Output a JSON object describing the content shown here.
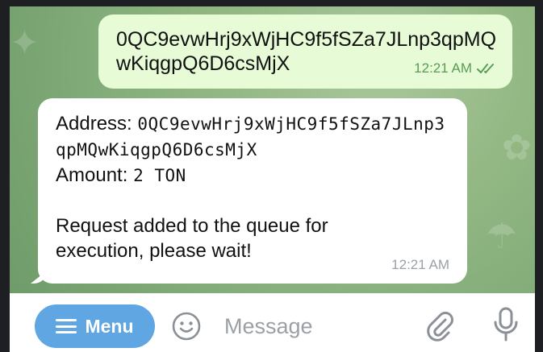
{
  "outgoing": {
    "text": "0QC9evwHrj9xWjHC9f5fSZa7JLnp3qpMQwKiqgpQ6D6csMjX",
    "time": "12:21 AM",
    "status_icon": "double-check-icon"
  },
  "incoming": {
    "address_label": "Address:",
    "address_value": "0QC9evwHrj9xWjHC9f5fSZa7JLnp3qpMQwKiqgpQ6D6csMjX",
    "amount_label": "Amount:",
    "amount_value": "2 TON",
    "message": "Request added to the queue for execution, please wait!",
    "time": "12:21 AM"
  },
  "input_bar": {
    "menu_label": "Menu",
    "placeholder": "Message"
  },
  "colors": {
    "outgoing_bubble": "#e7fbd6",
    "incoming_bubble": "#ffffff",
    "menu_button": "#5fa6e3",
    "check": "#5a9c55"
  }
}
